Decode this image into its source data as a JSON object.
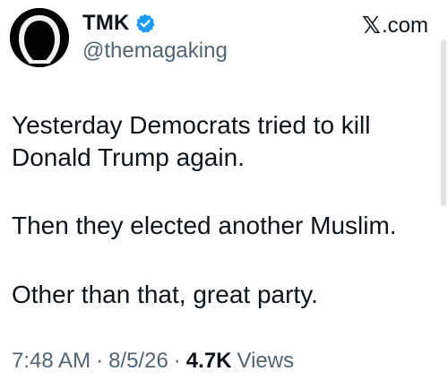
{
  "author": {
    "display_name": "TMK",
    "handle": "@themagaking",
    "verified": true,
    "avatar_icon": "hooded-figure-icon",
    "verified_color": "#1d9bf0"
  },
  "source": {
    "icon": "x-logo-icon",
    "glyph": "𝕏",
    "label": ".com"
  },
  "tweet": {
    "paragraphs": [
      "Yesterday Democrats tried to kill Donald Trump again.",
      "Then they elected another Muslim.",
      "Other than that, great party."
    ]
  },
  "meta": {
    "time": "7:48 AM",
    "separator": "·",
    "date": "8/5/26",
    "views_count": "4.7K",
    "views_label": "Views"
  }
}
